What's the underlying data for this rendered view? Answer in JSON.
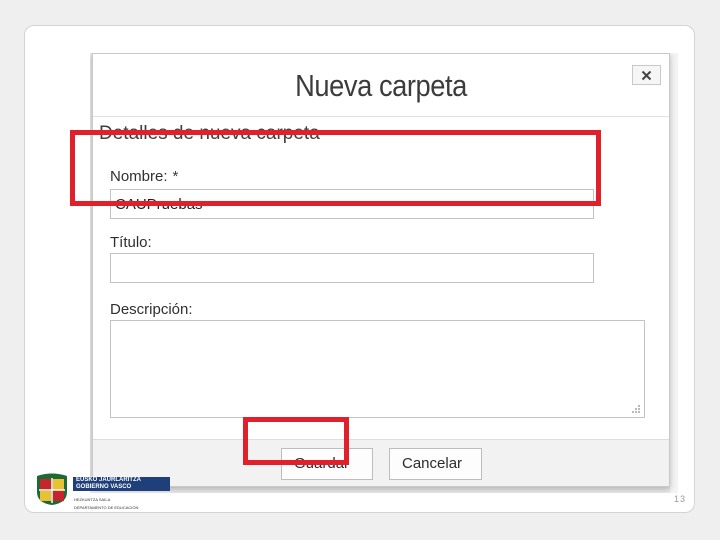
{
  "dialog": {
    "title": "Nueva carpeta",
    "close_label": "×",
    "section_title": "Detalles de nueva carpeta"
  },
  "form": {
    "name_label": "Nombre:",
    "required_mark": "*",
    "name_value": "CAUPruebas",
    "title_label": "Título:",
    "title_value": "",
    "description_label": "Descripción:",
    "description_value": ""
  },
  "buttons": {
    "save_label": "Guardar",
    "cancel_label": "Cancelar"
  },
  "logo": {
    "line1": "EUSKO JAURLARITZA",
    "line2": "GOBIERNO VASCO",
    "dept1": "HEZKUNTZA SAILA",
    "dept2": "DEPARTAMENTO DE EDUCACIÓN"
  },
  "slide": {
    "page_number": "13"
  },
  "colors": {
    "highlight": "#e0202a",
    "logo_blue": "#1f3f7a"
  }
}
